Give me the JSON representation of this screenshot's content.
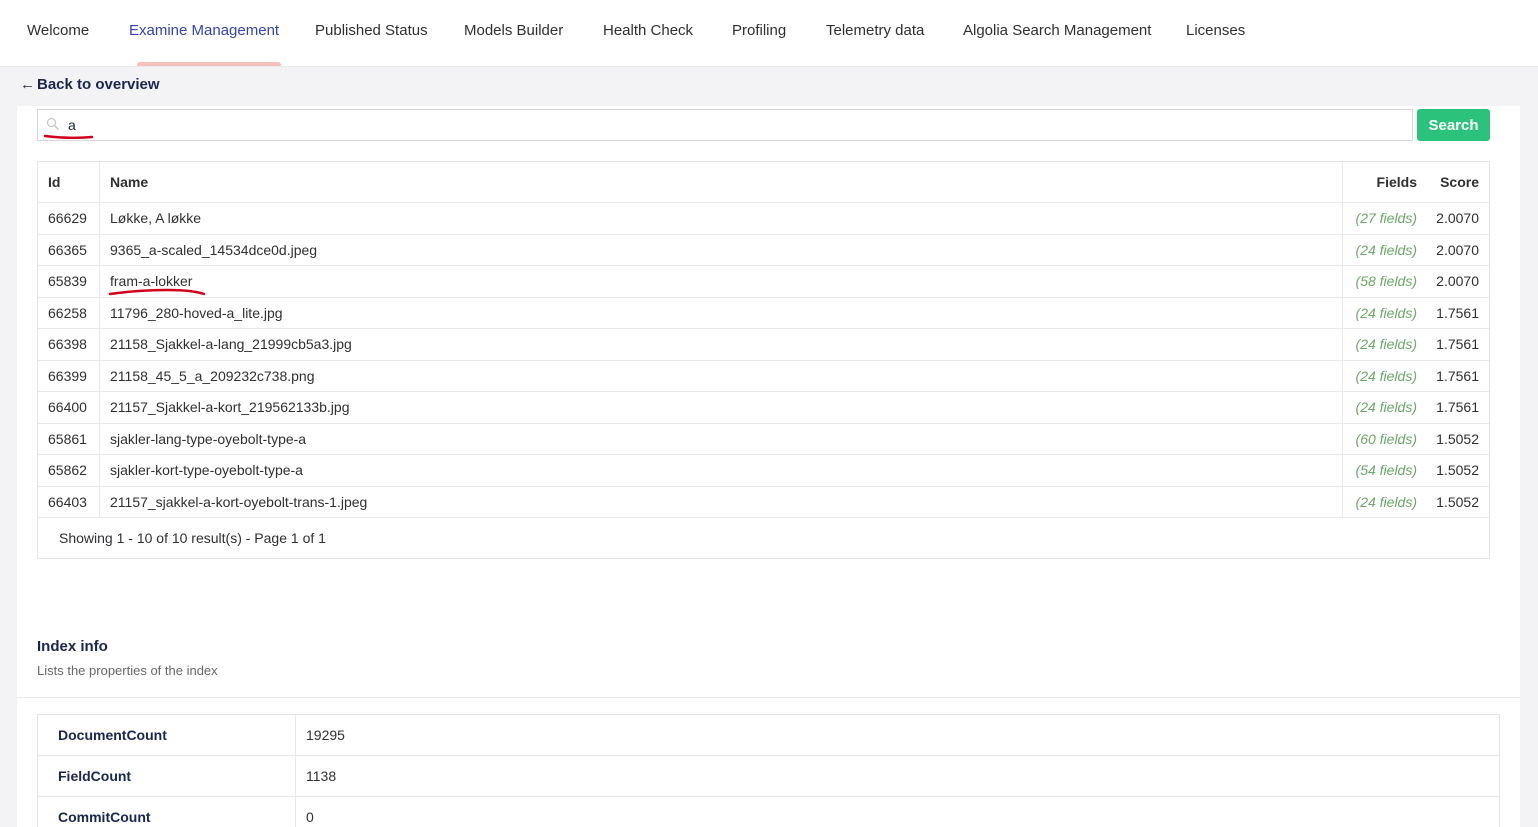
{
  "tabs": [
    {
      "label": "Welcome"
    },
    {
      "label": "Examine Management"
    },
    {
      "label": "Published Status"
    },
    {
      "label": "Models Builder"
    },
    {
      "label": "Health Check"
    },
    {
      "label": "Profiling"
    },
    {
      "label": "Telemetry data"
    },
    {
      "label": "Algolia Search Management"
    },
    {
      "label": "Licenses"
    }
  ],
  "active_tab": "Examine Management",
  "back_link": {
    "arrow": "←",
    "label": "Back to overview"
  },
  "search": {
    "value": "a",
    "button_label": "Search"
  },
  "results": {
    "headers": {
      "id": "Id",
      "name": "Name",
      "fields": "Fields",
      "score": "Score"
    },
    "rows": [
      {
        "id": "66629",
        "name": "Løkke, A løkke",
        "fields": "(27 fields)",
        "score": "2.0070"
      },
      {
        "id": "66365",
        "name": "9365_a-scaled_14534dce0d.jpeg",
        "fields": "(24 fields)",
        "score": "2.0070"
      },
      {
        "id": "65839",
        "name": "fram-a-lokker",
        "fields": "(58 fields)",
        "score": "2.0070"
      },
      {
        "id": "66258",
        "name": "11796_280-hoved-a_lite.jpg",
        "fields": "(24 fields)",
        "score": "1.7561"
      },
      {
        "id": "66398",
        "name": "21158_Sjakkel-a-lang_21999cb5a3.jpg",
        "fields": "(24 fields)",
        "score": "1.7561"
      },
      {
        "id": "66399",
        "name": "21158_45_5_a_209232c738.png",
        "fields": "(24 fields)",
        "score": "1.7561"
      },
      {
        "id": "66400",
        "name": "21157_Sjakkel-a-kort_219562133b.jpg",
        "fields": "(24 fields)",
        "score": "1.7561"
      },
      {
        "id": "65861",
        "name": "sjakler-lang-type-oyebolt-type-a",
        "fields": "(60 fields)",
        "score": "1.5052"
      },
      {
        "id": "65862",
        "name": "sjakler-kort-type-oyebolt-type-a",
        "fields": "(54 fields)",
        "score": "1.5052"
      },
      {
        "id": "66403",
        "name": "21157_sjakkel-a-kort-oyebolt-trans-1.jpeg",
        "fields": "(24 fields)",
        "score": "1.5052"
      }
    ],
    "footer": "Showing 1 - 10 of 10 result(s) - Page 1 of 1"
  },
  "index_info": {
    "title": "Index info",
    "description": "Lists the properties of the index",
    "properties": [
      {
        "key": "DocumentCount",
        "value": "19295"
      },
      {
        "key": "FieldCount",
        "value": "1138"
      },
      {
        "key": "CommitCount",
        "value": "0"
      }
    ]
  },
  "colors": {
    "active_tab": "#3544b1",
    "tab_indicator": "#f5c1bc",
    "search_button": "#2bc37c",
    "fields_link": "#6aa76a",
    "annotation": "#d0021b"
  }
}
